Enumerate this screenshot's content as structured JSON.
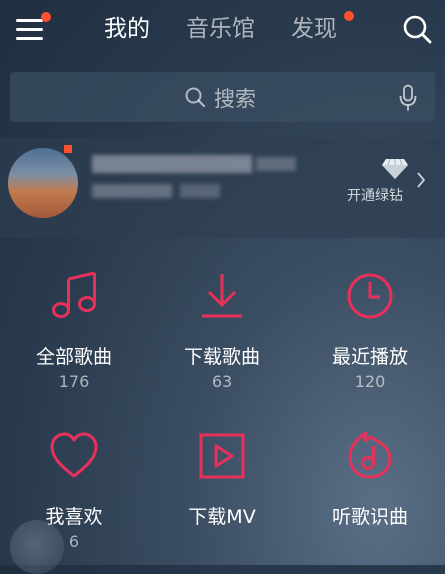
{
  "colors": {
    "accent": "#e8315a",
    "badge": "#ff4f2f"
  },
  "nav": {
    "tabs": [
      {
        "label": "我的",
        "active": true
      },
      {
        "label": "音乐馆",
        "active": false
      },
      {
        "label": "发现",
        "active": false,
        "badge": true
      }
    ],
    "menu_icon": "hamburger-menu-icon",
    "search_icon": "search-icon"
  },
  "search": {
    "placeholder": "搜索",
    "icon": "search-icon",
    "voice_icon": "microphone-icon"
  },
  "profile": {
    "vip_label": "开通绿钻",
    "vip_icon": "diamond-icon",
    "arrow_icon": "chevron-right-icon"
  },
  "tiles": [
    {
      "label": "全部歌曲",
      "count": "176",
      "icon": "music-note-icon"
    },
    {
      "label": "下载歌曲",
      "count": "63",
      "icon": "download-icon"
    },
    {
      "label": "最近播放",
      "count": "120",
      "icon": "clock-icon"
    },
    {
      "label": "我喜欢",
      "count": "6",
      "icon": "heart-icon"
    },
    {
      "label": "下载MV",
      "count": "",
      "icon": "video-play-icon"
    },
    {
      "label": "听歌识曲",
      "count": "",
      "icon": "music-recognition-icon"
    }
  ]
}
